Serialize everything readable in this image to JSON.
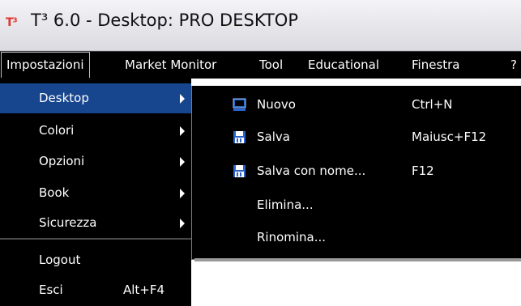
{
  "window": {
    "app_logo_text": "T³",
    "title": "T³ 6.0 - Desktop: PRO DESKTOP"
  },
  "menubar": {
    "items": [
      {
        "label": "Impostazioni"
      },
      {
        "label": "Market Monitor"
      },
      {
        "label": "Tool"
      },
      {
        "label": "Educational"
      },
      {
        "label": "Finestra"
      },
      {
        "label": "?"
      }
    ]
  },
  "impostazioni_menu": {
    "items": [
      {
        "label": "Desktop",
        "submenu": true
      },
      {
        "label": "Colori",
        "submenu": true
      },
      {
        "label": "Opzioni",
        "submenu": true
      },
      {
        "label": "Book",
        "submenu": true
      },
      {
        "label": "Sicurezza",
        "submenu": true
      },
      {
        "label": "Logout"
      },
      {
        "label": "Esci",
        "shortcut": "Alt+F4"
      }
    ]
  },
  "desktop_submenu": {
    "items": [
      {
        "label": "Nuovo",
        "shortcut": "Ctrl+N",
        "icon": "monitor-icon"
      },
      {
        "label": "Salva",
        "shortcut": "Maiusc+F12",
        "icon": "floppy-disk-icon"
      },
      {
        "label": "Salva con nome...",
        "shortcut": "F12",
        "icon": "floppy-disk-icon"
      },
      {
        "label": "Elimina..."
      },
      {
        "label": "Rinomina..."
      }
    ]
  },
  "colors": {
    "menu_bg": "#000000",
    "highlight": "#17468e",
    "logo": "#e2342b",
    "icon_blue": "#2a63c9"
  }
}
